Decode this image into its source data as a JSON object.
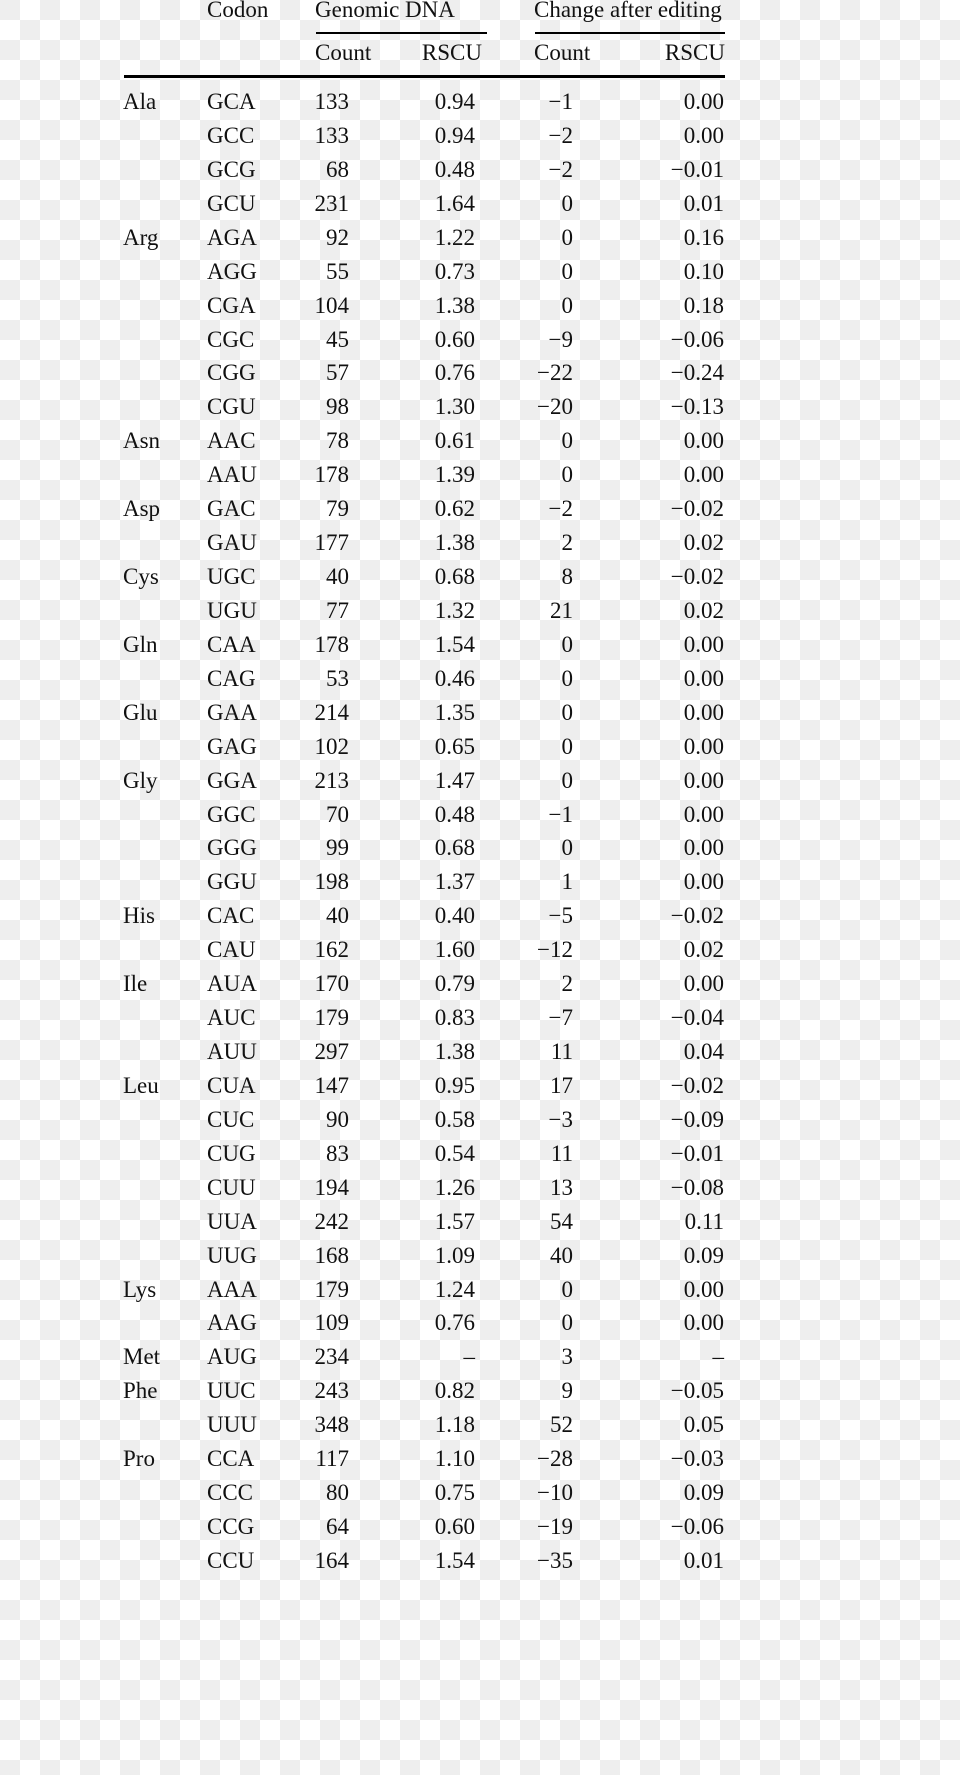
{
  "header": {
    "codon": "Codon",
    "genomic_dna": "Genomic DNA",
    "change_after_editing": "Change after editing",
    "count": "Count",
    "rscu": "RSCU",
    "change_count": "Count",
    "change_rscu": "RSCU"
  },
  "rows": [
    {
      "aa": "Ala",
      "codon": "GCA",
      "count": "133",
      "rscu": "0.94",
      "d_count": "−1",
      "d_rscu": "0.00"
    },
    {
      "aa": "",
      "codon": "GCC",
      "count": "133",
      "rscu": "0.94",
      "d_count": "−2",
      "d_rscu": "0.00"
    },
    {
      "aa": "",
      "codon": "GCG",
      "count": "68",
      "rscu": "0.48",
      "d_count": "−2",
      "d_rscu": "−0.01"
    },
    {
      "aa": "",
      "codon": "GCU",
      "count": "231",
      "rscu": "1.64",
      "d_count": "0",
      "d_rscu": "0.01"
    },
    {
      "aa": "Arg",
      "codon": "AGA",
      "count": "92",
      "rscu": "1.22",
      "d_count": "0",
      "d_rscu": "0.16"
    },
    {
      "aa": "",
      "codon": "AGG",
      "count": "55",
      "rscu": "0.73",
      "d_count": "0",
      "d_rscu": "0.10"
    },
    {
      "aa": "",
      "codon": "CGA",
      "count": "104",
      "rscu": "1.38",
      "d_count": "0",
      "d_rscu": "0.18"
    },
    {
      "aa": "",
      "codon": "CGC",
      "count": "45",
      "rscu": "0.60",
      "d_count": "−9",
      "d_rscu": "−0.06"
    },
    {
      "aa": "",
      "codon": "CGG",
      "count": "57",
      "rscu": "0.76",
      "d_count": "−22",
      "d_rscu": "−0.24"
    },
    {
      "aa": "",
      "codon": "CGU",
      "count": "98",
      "rscu": "1.30",
      "d_count": "−20",
      "d_rscu": "−0.13"
    },
    {
      "aa": "Asn",
      "codon": "AAC",
      "count": "78",
      "rscu": "0.61",
      "d_count": "0",
      "d_rscu": "0.00"
    },
    {
      "aa": "",
      "codon": "AAU",
      "count": "178",
      "rscu": "1.39",
      "d_count": "0",
      "d_rscu": "0.00"
    },
    {
      "aa": "Asp",
      "codon": "GAC",
      "count": "79",
      "rscu": "0.62",
      "d_count": "−2",
      "d_rscu": "−0.02"
    },
    {
      "aa": "",
      "codon": "GAU",
      "count": "177",
      "rscu": "1.38",
      "d_count": "2",
      "d_rscu": "0.02"
    },
    {
      "aa": "Cys",
      "codon": "UGC",
      "count": "40",
      "rscu": "0.68",
      "d_count": "8",
      "d_rscu": "−0.02"
    },
    {
      "aa": "",
      "codon": "UGU",
      "count": "77",
      "rscu": "1.32",
      "d_count": "21",
      "d_rscu": "0.02"
    },
    {
      "aa": "Gln",
      "codon": "CAA",
      "count": "178",
      "rscu": "1.54",
      "d_count": "0",
      "d_rscu": "0.00"
    },
    {
      "aa": "",
      "codon": "CAG",
      "count": "53",
      "rscu": "0.46",
      "d_count": "0",
      "d_rscu": "0.00"
    },
    {
      "aa": "Glu",
      "codon": "GAA",
      "count": "214",
      "rscu": "1.35",
      "d_count": "0",
      "d_rscu": "0.00"
    },
    {
      "aa": "",
      "codon": "GAG",
      "count": "102",
      "rscu": "0.65",
      "d_count": "0",
      "d_rscu": "0.00"
    },
    {
      "aa": "Gly",
      "codon": "GGA",
      "count": "213",
      "rscu": "1.47",
      "d_count": "0",
      "d_rscu": "0.00"
    },
    {
      "aa": "",
      "codon": "GGC",
      "count": "70",
      "rscu": "0.48",
      "d_count": "−1",
      "d_rscu": "0.00"
    },
    {
      "aa": "",
      "codon": "GGG",
      "count": "99",
      "rscu": "0.68",
      "d_count": "0",
      "d_rscu": "0.00"
    },
    {
      "aa": "",
      "codon": "GGU",
      "count": "198",
      "rscu": "1.37",
      "d_count": "1",
      "d_rscu": "0.00"
    },
    {
      "aa": "His",
      "codon": "CAC",
      "count": "40",
      "rscu": "0.40",
      "d_count": "−5",
      "d_rscu": "−0.02"
    },
    {
      "aa": "",
      "codon": "CAU",
      "count": "162",
      "rscu": "1.60",
      "d_count": "−12",
      "d_rscu": "0.02"
    },
    {
      "aa": "Ile",
      "codon": "AUA",
      "count": "170",
      "rscu": "0.79",
      "d_count": "2",
      "d_rscu": "0.00"
    },
    {
      "aa": "",
      "codon": "AUC",
      "count": "179",
      "rscu": "0.83",
      "d_count": "−7",
      "d_rscu": "−0.04"
    },
    {
      "aa": "",
      "codon": "AUU",
      "count": "297",
      "rscu": "1.38",
      "d_count": "11",
      "d_rscu": "0.04"
    },
    {
      "aa": "Leu",
      "codon": "CUA",
      "count": "147",
      "rscu": "0.95",
      "d_count": "17",
      "d_rscu": "−0.02"
    },
    {
      "aa": "",
      "codon": "CUC",
      "count": "90",
      "rscu": "0.58",
      "d_count": "−3",
      "d_rscu": "−0.09"
    },
    {
      "aa": "",
      "codon": "CUG",
      "count": "83",
      "rscu": "0.54",
      "d_count": "11",
      "d_rscu": "−0.01"
    },
    {
      "aa": "",
      "codon": "CUU",
      "count": "194",
      "rscu": "1.26",
      "d_count": "13",
      "d_rscu": "−0.08"
    },
    {
      "aa": "",
      "codon": "UUA",
      "count": "242",
      "rscu": "1.57",
      "d_count": "54",
      "d_rscu": "0.11"
    },
    {
      "aa": "",
      "codon": "UUG",
      "count": "168",
      "rscu": "1.09",
      "d_count": "40",
      "d_rscu": "0.09"
    },
    {
      "aa": "Lys",
      "codon": "AAA",
      "count": "179",
      "rscu": "1.24",
      "d_count": "0",
      "d_rscu": "0.00"
    },
    {
      "aa": "",
      "codon": "AAG",
      "count": "109",
      "rscu": "0.76",
      "d_count": "0",
      "d_rscu": "0.00"
    },
    {
      "aa": "Met",
      "codon": "AUG",
      "count": "234",
      "rscu": "–",
      "d_count": "3",
      "d_rscu": "–"
    },
    {
      "aa": "Phe",
      "codon": "UUC",
      "count": "243",
      "rscu": "0.82",
      "d_count": "9",
      "d_rscu": "−0.05"
    },
    {
      "aa": "",
      "codon": "UUU",
      "count": "348",
      "rscu": "1.18",
      "d_count": "52",
      "d_rscu": "0.05"
    },
    {
      "aa": "Pro",
      "codon": "CCA",
      "count": "117",
      "rscu": "1.10",
      "d_count": "−28",
      "d_rscu": "−0.03"
    },
    {
      "aa": "",
      "codon": "CCC",
      "count": "80",
      "rscu": "0.75",
      "d_count": "−10",
      "d_rscu": "0.09"
    },
    {
      "aa": "",
      "codon": "CCG",
      "count": "64",
      "rscu": "0.60",
      "d_count": "−19",
      "d_rscu": "−0.06"
    },
    {
      "aa": "",
      "codon": "CCU",
      "count": "164",
      "rscu": "1.54",
      "d_count": "−35",
      "d_rscu": "0.01"
    }
  ]
}
